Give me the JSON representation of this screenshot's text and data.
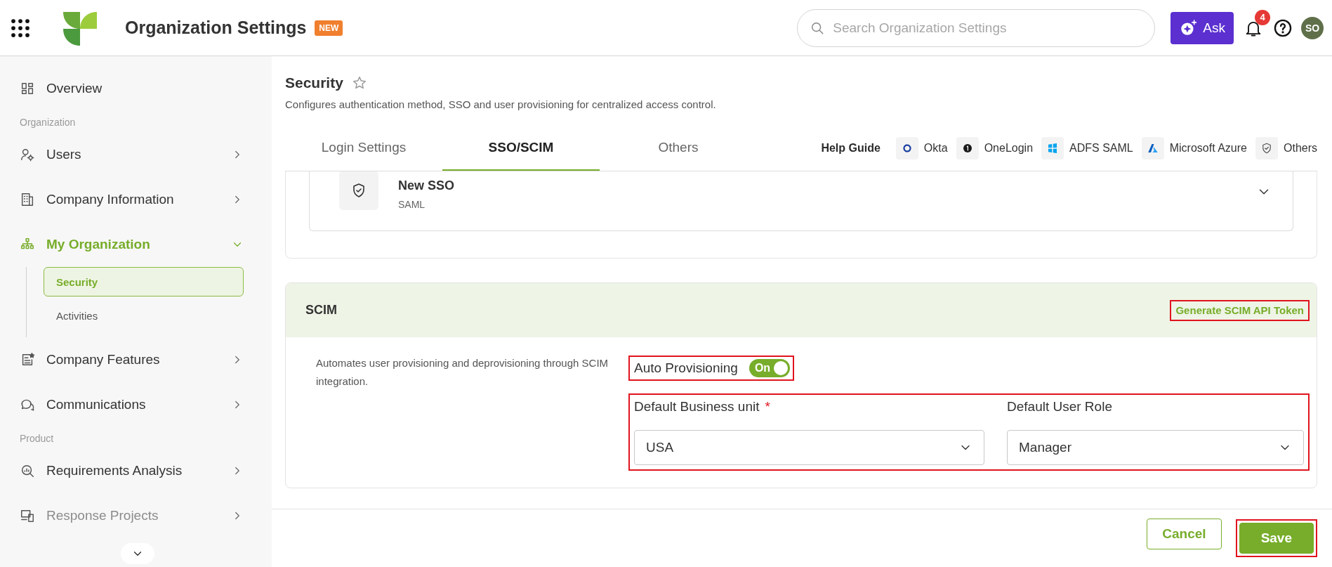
{
  "header": {
    "app_title": "Organization Settings",
    "badge": "NEW",
    "search": {
      "placeholder": "Search Organization Settings"
    },
    "ask_button": "Ask",
    "notification_count": "4",
    "avatar": "SO"
  },
  "sidebar": {
    "entries": [
      {
        "kind": "item",
        "label": "Overview",
        "selected": false
      },
      {
        "kind": "heading",
        "label": "Organization"
      },
      {
        "kind": "item",
        "label": "Users",
        "expanded": false,
        "selected": false
      },
      {
        "kind": "item",
        "label": "Company Information",
        "expanded": false,
        "selected": false
      },
      {
        "kind": "item",
        "label": "My Organization",
        "expanded": true,
        "selected": true,
        "children": [
          {
            "label": "Security",
            "selected": true
          },
          {
            "label": "Activities",
            "selected": false
          }
        ]
      },
      {
        "kind": "item",
        "label": "Company Features",
        "expanded": false,
        "selected": false
      },
      {
        "kind": "item",
        "label": "Communications",
        "expanded": false,
        "selected": false
      },
      {
        "kind": "heading",
        "label": "Product"
      },
      {
        "kind": "item",
        "label": "Requirements Analysis",
        "expanded": false,
        "selected": false
      },
      {
        "kind": "item",
        "label": "Response Projects",
        "expanded": false,
        "selected": false
      }
    ]
  },
  "page": {
    "title": "Security",
    "favorite": false,
    "description": "Configures authentication method, SSO and user provisioning for centralized access control.",
    "tabs": [
      {
        "label": "Login Settings",
        "selected": false
      },
      {
        "label": "SSO/SCIM",
        "selected": true
      },
      {
        "label": "Others",
        "selected": false
      }
    ],
    "help_guide": {
      "label": "Help Guide",
      "links": [
        "Okta",
        "OneLogin",
        "ADFS SAML",
        "Microsoft Azure",
        "Others"
      ]
    }
  },
  "sso": {
    "name": "New SSO",
    "type": "SAML",
    "expanded": false
  },
  "scim": {
    "title": "SCIM",
    "token_link": {
      "label": "Generate SCIM API Token",
      "highlighted": true
    },
    "description": "Automates user provisioning and deprovisioning through SCIM integration.",
    "auto_provisioning": {
      "label": "Auto Provisioning",
      "on": true,
      "state_text": "On",
      "highlighted": true
    },
    "fields_highlighted": true,
    "fields": [
      {
        "label": "Default Business unit",
        "required_mark": "*",
        "value": "USA"
      },
      {
        "label": "Default User Role",
        "value": "Manager"
      }
    ]
  },
  "footer": {
    "buttons": [
      {
        "kind": "secondary",
        "label": "Cancel",
        "highlighted": false
      },
      {
        "kind": "primary",
        "label": "Save",
        "highlighted": true
      }
    ]
  }
}
